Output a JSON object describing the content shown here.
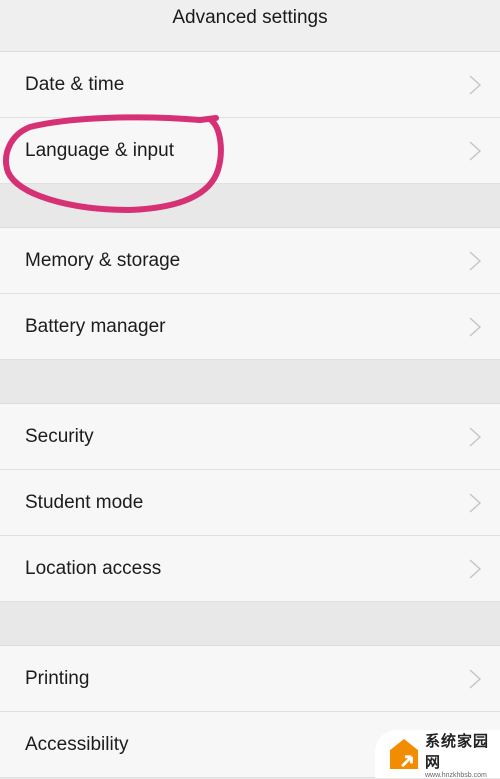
{
  "header": {
    "title": "Advanced settings"
  },
  "groups": [
    {
      "items": [
        {
          "label": "Date & time"
        },
        {
          "label": "Language & input"
        }
      ]
    },
    {
      "items": [
        {
          "label": "Memory & storage"
        },
        {
          "label": "Battery manager"
        }
      ]
    },
    {
      "items": [
        {
          "label": "Security"
        },
        {
          "label": "Student mode"
        },
        {
          "label": "Location access"
        }
      ]
    },
    {
      "items": [
        {
          "label": "Printing"
        },
        {
          "label": "Accessibility"
        }
      ]
    }
  ],
  "annotation": {
    "target": "Language & input",
    "color": "#d63175"
  },
  "watermark": {
    "name": "系统家园网",
    "url": "www.hnzkhbsb.com",
    "logo_color": "#f28c00"
  }
}
